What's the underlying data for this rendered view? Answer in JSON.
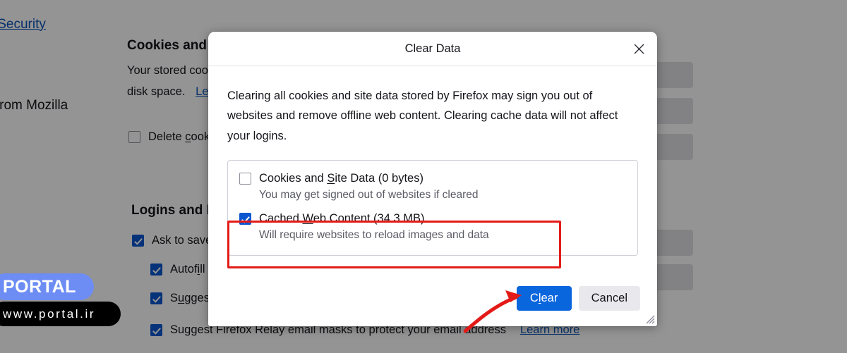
{
  "background_page": {
    "sidebar_link": "cy & Security",
    "sidebar_sub": "e from Mozilla",
    "section_cookies": {
      "heading": "Cookies and",
      "line1": "Your stored coo",
      "line2_prefix": "disk space.",
      "line2_link": "Le",
      "checkbox_label": "Delete cook",
      "checkbox_checked": false
    },
    "section_logins": {
      "heading": "Logins and P",
      "rows": [
        {
          "label": "Ask to save",
          "checked": true,
          "indent": false
        },
        {
          "label": "Autofill",
          "checked": true,
          "indent": true
        },
        {
          "label": "Suggest",
          "checked": true,
          "indent": true
        },
        {
          "label": "Suggest Firefox Relay email masks to protect your email address",
          "checked": true,
          "indent": true
        }
      ],
      "learn_more": "Learn more"
    }
  },
  "dialog": {
    "title": "Clear Data",
    "close_icon": "close-icon",
    "description": "Clearing all cookies and site data stored by Firefox may sign you out of websites and remove offline web content. Clearing cache data will not affect your logins.",
    "choices": [
      {
        "label_before": "Cookies and ",
        "label_accesskey": "S",
        "label_after": "ite Data (0 bytes)",
        "sublabel": "You may get signed out of websites if cleared",
        "checked": false,
        "highlighted": false
      },
      {
        "label_before": "Cached ",
        "label_accesskey": "W",
        "label_after": "eb Content (34.3 MB)",
        "sublabel": "Will require websites to reload images and data",
        "checked": true,
        "highlighted": true
      }
    ],
    "buttons": {
      "primary_before": "C",
      "primary_accesskey": "l",
      "primary_after": "ear",
      "secondary": "Cancel"
    },
    "resize_grip_icon": "resize-grip-icon"
  },
  "annotations": {
    "highlight_color": "#e31b18",
    "arrow_color": "#e31b18",
    "arrow_target": "clear-button"
  },
  "watermark": {
    "brand": "PORTAL",
    "url": "www.portal.ir",
    "brand_bg": "#6d8df4",
    "url_bg": "#000000"
  },
  "theme": {
    "accent": "#0a66dd",
    "link": "#0a53b8",
    "text": "#15141a",
    "muted_text": "#5b5b66",
    "dialog_bg": "#ffffff",
    "page_scrim": "#000000"
  }
}
